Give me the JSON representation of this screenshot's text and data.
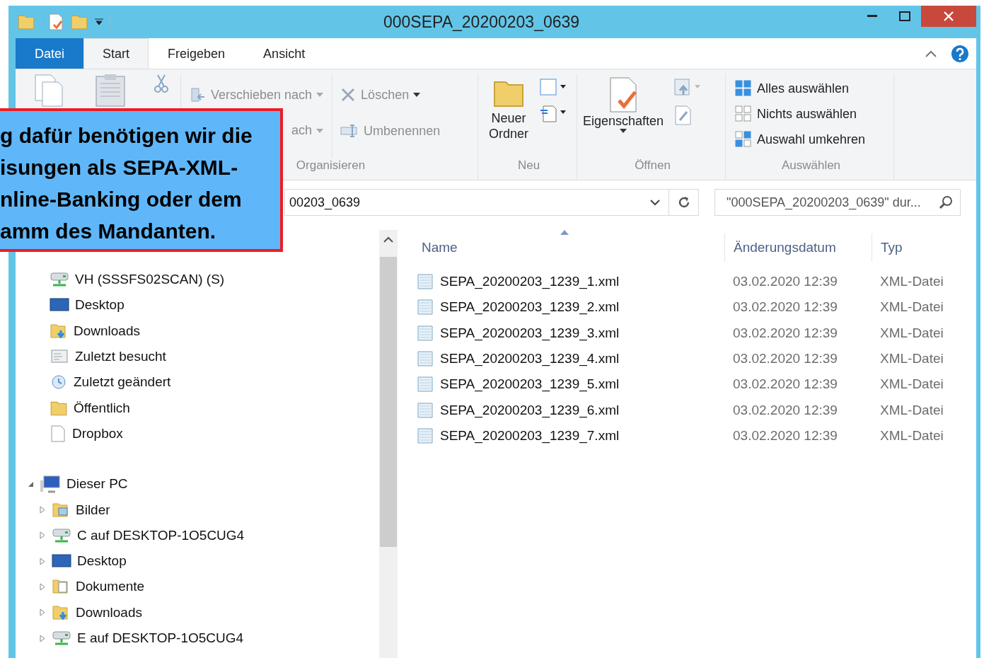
{
  "window": {
    "title": "000SEPA_20200203_0639"
  },
  "ribbon_tabs": [
    {
      "label": "Datei",
      "kind": "file",
      "selected": false
    },
    {
      "label": "Start",
      "kind": "tab",
      "selected": true
    },
    {
      "label": "Freigeben",
      "kind": "tab",
      "selected": false
    },
    {
      "label": "Ansicht",
      "kind": "tab",
      "selected": false
    }
  ],
  "organize": {
    "label": "Organisieren",
    "items": [
      {
        "label": "Verschieben nach",
        "kind": "move",
        "dropdown": true,
        "disabled": true
      },
      {
        "label": "ach",
        "kind": "copyto",
        "dropdown": true,
        "disabled": true
      },
      {
        "label": "Löschen",
        "kind": "delete",
        "dropdown": true,
        "disabled": true
      },
      {
        "label": "Umbenennen",
        "kind": "rename",
        "dropdown": false,
        "disabled": true
      }
    ]
  },
  "new_group": {
    "label": "Neu",
    "button": "Neuer Ordner"
  },
  "open_group": {
    "label": "Öffnen",
    "button": "Eigenschaften"
  },
  "select_group": {
    "label": "Auswählen",
    "items": [
      {
        "label": "Alles auswählen",
        "kind": "all"
      },
      {
        "label": "Nichts auswählen",
        "kind": "none"
      },
      {
        "label": "Auswahl umkehren",
        "kind": "invert"
      }
    ]
  },
  "address": {
    "path": "00203_0639"
  },
  "search": {
    "placeholder": "\"000SEPA_20200203_0639\" dur..."
  },
  "favorites": [
    {
      "label": "VH (SSSFS02SCAN) (S)",
      "kind": "network"
    },
    {
      "label": "Desktop",
      "kind": "desktop"
    },
    {
      "label": "Downloads",
      "kind": "downloads"
    },
    {
      "label": "Zuletzt besucht",
      "kind": "recent"
    },
    {
      "label": "Zuletzt geändert",
      "kind": "changed"
    },
    {
      "label": "Öffentlich",
      "kind": "folder"
    },
    {
      "label": "Dropbox",
      "kind": "page"
    }
  ],
  "this_pc": {
    "label": "Dieser PC",
    "expanded": true,
    "children": [
      {
        "label": "Bilder",
        "kind": "pictures",
        "expanded": false
      },
      {
        "label": "C auf DESKTOP-1O5CUG4",
        "kind": "network",
        "expanded": false
      },
      {
        "label": "Desktop",
        "kind": "desktop",
        "expanded": false
      },
      {
        "label": "Dokumente",
        "kind": "documents",
        "expanded": false
      },
      {
        "label": "Downloads",
        "kind": "downloads",
        "expanded": false
      },
      {
        "label": "E auf DESKTOP-1O5CUG4",
        "kind": "network",
        "expanded": false
      }
    ]
  },
  "columns": [
    "Name",
    "Änderungsdatum",
    "Typ"
  ],
  "files": [
    {
      "name": "SEPA_20200203_1239_1.xml",
      "date": "03.02.2020 12:39",
      "type": "XML-Datei"
    },
    {
      "name": "SEPA_20200203_1239_2.xml",
      "date": "03.02.2020 12:39",
      "type": "XML-Datei"
    },
    {
      "name": "SEPA_20200203_1239_3.xml",
      "date": "03.02.2020 12:39",
      "type": "XML-Datei"
    },
    {
      "name": "SEPA_20200203_1239_4.xml",
      "date": "03.02.2020 12:39",
      "type": "XML-Datei"
    },
    {
      "name": "SEPA_20200203_1239_5.xml",
      "date": "03.02.2020 12:39",
      "type": "XML-Datei"
    },
    {
      "name": "SEPA_20200203_1239_6.xml",
      "date": "03.02.2020 12:39",
      "type": "XML-Datei"
    },
    {
      "name": "SEPA_20200203_1239_7.xml",
      "date": "03.02.2020 12:39",
      "type": "XML-Datei"
    }
  ],
  "callout": {
    "lines": [
      "g dafür benötigen wir die",
      "isungen als SEPA-XML-",
      "nline-Banking oder dem",
      "amm des Mandanten."
    ]
  }
}
